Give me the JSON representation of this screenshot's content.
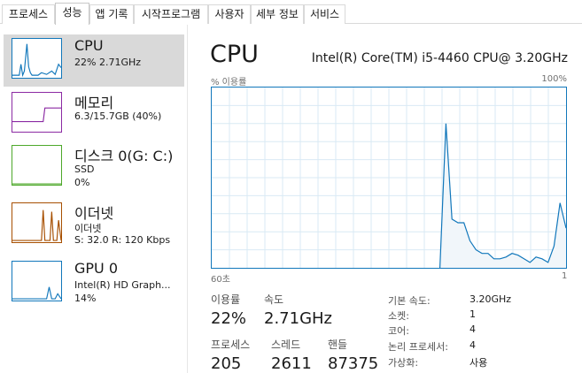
{
  "tabs": [
    {
      "label": "프로세스",
      "active": false
    },
    {
      "label": "성능",
      "active": true
    },
    {
      "label": "앱 기록",
      "active": false
    },
    {
      "label": "시작프로그램",
      "active": false
    },
    {
      "label": "사용자",
      "active": false
    },
    {
      "label": "세부 정보",
      "active": false
    },
    {
      "label": "서비스",
      "active": false
    }
  ],
  "sidebar": {
    "items": [
      {
        "title": "CPU",
        "sub1": "22% 2.71GHz",
        "sub2": "",
        "selected": true,
        "color": "#1177bb"
      },
      {
        "title": "메모리",
        "sub1": "6.3/15.7GB (40%)",
        "sub2": "",
        "selected": false,
        "color": "#8b2aa3"
      },
      {
        "title": "디스크 0(G: C:)",
        "sub1": "SSD",
        "sub2": "0%",
        "selected": false,
        "color": "#4da82a"
      },
      {
        "title": "이더넷",
        "sub1": "이더넷",
        "sub2": "S: 32.0  R: 120 Kbps",
        "selected": false,
        "color": "#a74f01"
      },
      {
        "title": "GPU 0",
        "sub1": "Intel(R) HD Graph...",
        "sub2": "14%",
        "selected": false,
        "color": "#1177bb"
      }
    ]
  },
  "main": {
    "title": "CPU",
    "model": "Intel(R) Core(TM) i5-4460 CPU@ 3.20GHz",
    "graph": {
      "y_label": "% 이용률",
      "y_max_label": "100%",
      "x_left_label": "60초",
      "x_right_label": "1",
      "line_color": "#1177bb",
      "fill_color": "#f1f6fa",
      "grid_color": "#d9eaf4"
    },
    "stats": {
      "usage_label": "이용률",
      "usage_value": "22%",
      "speed_label": "속도",
      "speed_value": "2.71GHz",
      "processes_label": "프로세스",
      "processes_value": "205",
      "threads_label": "스레드",
      "threads_value": "2611",
      "handles_label": "핸들",
      "handles_value": "87375"
    },
    "info": [
      {
        "key": "기본 속도:",
        "value": "3.20GHz"
      },
      {
        "key": "소켓:",
        "value": "1"
      },
      {
        "key": "코어:",
        "value": "4"
      },
      {
        "key": "논리 프로세서:",
        "value": "4"
      },
      {
        "key": "가상화:",
        "value": "사용"
      }
    ]
  },
  "chart_data": {
    "type": "area",
    "x": [
      60,
      59,
      58,
      57,
      56,
      55,
      54,
      53,
      52,
      51,
      50,
      49,
      48,
      47,
      46,
      45,
      44,
      43,
      42,
      41,
      40,
      39,
      38,
      37,
      36,
      35,
      34,
      33,
      32,
      31,
      30,
      29,
      28,
      27,
      26,
      25,
      24,
      23,
      22,
      21,
      20,
      19,
      18,
      17,
      16,
      15,
      14,
      13,
      12,
      11,
      10,
      9,
      8,
      7,
      6,
      5,
      4,
      3,
      2,
      1
    ],
    "series": [
      {
        "values": [
          0,
          0,
          0,
          0,
          0,
          0,
          0,
          0,
          0,
          0,
          0,
          0,
          0,
          0,
          0,
          0,
          0,
          0,
          0,
          0,
          0,
          0,
          0,
          0,
          0,
          0,
          0,
          0,
          0,
          0,
          0,
          0,
          0,
          0,
          0,
          0,
          0,
          0,
          0,
          80,
          27,
          25,
          25,
          15,
          10,
          8,
          8,
          5,
          5,
          6,
          8,
          7,
          5,
          3,
          6,
          5,
          3,
          12,
          36,
          22
        ]
      }
    ],
    "ylim": [
      0,
      100
    ],
    "xlim": [
      60,
      1
    ],
    "xlabel": "",
    "ylabel": "% 이용률"
  }
}
